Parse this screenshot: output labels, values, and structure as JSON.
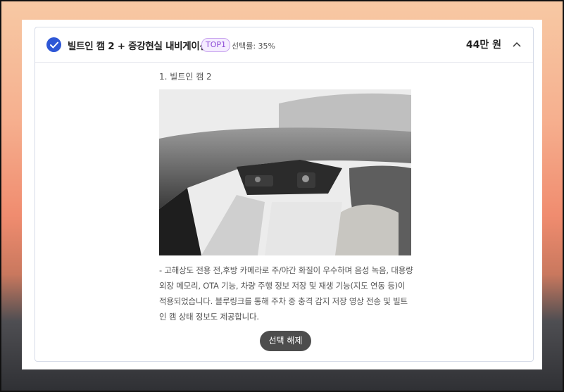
{
  "option": {
    "title": "빌트인 캠 2 + 증강현실 내비게이션",
    "badge": "TOP1",
    "rate": "선택률: 35%",
    "price": "44만 원"
  },
  "detail": {
    "item_title": "1. 빌트인 캠 2",
    "description": "- 고해상도 전용 전,후방 카메라로 주/야간 화질이 우수하며 음성 녹음, 대용량 외장 메모리, OTA 기능, 차량 주행 정보 저장 및 재생 기능(지도 연동 등)이 적용되었습니다. 블루링크를 통해 주차 중 충격 감지 저장 영상 전송 및 빌트인 캠 상태 정보도 제공합니다.",
    "deselect_label": "선택 해제"
  },
  "icons": {
    "check": "check-circle-icon",
    "collapse": "chevron-up-icon"
  },
  "colors": {
    "accent": "#2e57d6",
    "badge_text": "#8a47d6",
    "button": "#4d4d4d"
  }
}
